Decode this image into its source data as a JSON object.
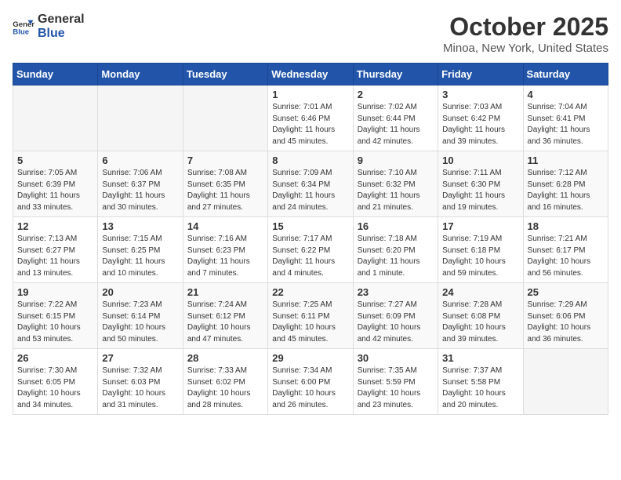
{
  "header": {
    "logo_general": "General",
    "logo_blue": "Blue",
    "month_title": "October 2025",
    "location": "Minoa, New York, United States"
  },
  "days_of_week": [
    "Sunday",
    "Monday",
    "Tuesday",
    "Wednesday",
    "Thursday",
    "Friday",
    "Saturday"
  ],
  "weeks": [
    [
      {
        "day": "",
        "info": ""
      },
      {
        "day": "",
        "info": ""
      },
      {
        "day": "",
        "info": ""
      },
      {
        "day": "1",
        "info": "Sunrise: 7:01 AM\nSunset: 6:46 PM\nDaylight: 11 hours and 45 minutes."
      },
      {
        "day": "2",
        "info": "Sunrise: 7:02 AM\nSunset: 6:44 PM\nDaylight: 11 hours and 42 minutes."
      },
      {
        "day": "3",
        "info": "Sunrise: 7:03 AM\nSunset: 6:42 PM\nDaylight: 11 hours and 39 minutes."
      },
      {
        "day": "4",
        "info": "Sunrise: 7:04 AM\nSunset: 6:41 PM\nDaylight: 11 hours and 36 minutes."
      }
    ],
    [
      {
        "day": "5",
        "info": "Sunrise: 7:05 AM\nSunset: 6:39 PM\nDaylight: 11 hours and 33 minutes."
      },
      {
        "day": "6",
        "info": "Sunrise: 7:06 AM\nSunset: 6:37 PM\nDaylight: 11 hours and 30 minutes."
      },
      {
        "day": "7",
        "info": "Sunrise: 7:08 AM\nSunset: 6:35 PM\nDaylight: 11 hours and 27 minutes."
      },
      {
        "day": "8",
        "info": "Sunrise: 7:09 AM\nSunset: 6:34 PM\nDaylight: 11 hours and 24 minutes."
      },
      {
        "day": "9",
        "info": "Sunrise: 7:10 AM\nSunset: 6:32 PM\nDaylight: 11 hours and 21 minutes."
      },
      {
        "day": "10",
        "info": "Sunrise: 7:11 AM\nSunset: 6:30 PM\nDaylight: 11 hours and 19 minutes."
      },
      {
        "day": "11",
        "info": "Sunrise: 7:12 AM\nSunset: 6:28 PM\nDaylight: 11 hours and 16 minutes."
      }
    ],
    [
      {
        "day": "12",
        "info": "Sunrise: 7:13 AM\nSunset: 6:27 PM\nDaylight: 11 hours and 13 minutes."
      },
      {
        "day": "13",
        "info": "Sunrise: 7:15 AM\nSunset: 6:25 PM\nDaylight: 11 hours and 10 minutes."
      },
      {
        "day": "14",
        "info": "Sunrise: 7:16 AM\nSunset: 6:23 PM\nDaylight: 11 hours and 7 minutes."
      },
      {
        "day": "15",
        "info": "Sunrise: 7:17 AM\nSunset: 6:22 PM\nDaylight: 11 hours and 4 minutes."
      },
      {
        "day": "16",
        "info": "Sunrise: 7:18 AM\nSunset: 6:20 PM\nDaylight: 11 hours and 1 minute."
      },
      {
        "day": "17",
        "info": "Sunrise: 7:19 AM\nSunset: 6:18 PM\nDaylight: 10 hours and 59 minutes."
      },
      {
        "day": "18",
        "info": "Sunrise: 7:21 AM\nSunset: 6:17 PM\nDaylight: 10 hours and 56 minutes."
      }
    ],
    [
      {
        "day": "19",
        "info": "Sunrise: 7:22 AM\nSunset: 6:15 PM\nDaylight: 10 hours and 53 minutes."
      },
      {
        "day": "20",
        "info": "Sunrise: 7:23 AM\nSunset: 6:14 PM\nDaylight: 10 hours and 50 minutes."
      },
      {
        "day": "21",
        "info": "Sunrise: 7:24 AM\nSunset: 6:12 PM\nDaylight: 10 hours and 47 minutes."
      },
      {
        "day": "22",
        "info": "Sunrise: 7:25 AM\nSunset: 6:11 PM\nDaylight: 10 hours and 45 minutes."
      },
      {
        "day": "23",
        "info": "Sunrise: 7:27 AM\nSunset: 6:09 PM\nDaylight: 10 hours and 42 minutes."
      },
      {
        "day": "24",
        "info": "Sunrise: 7:28 AM\nSunset: 6:08 PM\nDaylight: 10 hours and 39 minutes."
      },
      {
        "day": "25",
        "info": "Sunrise: 7:29 AM\nSunset: 6:06 PM\nDaylight: 10 hours and 36 minutes."
      }
    ],
    [
      {
        "day": "26",
        "info": "Sunrise: 7:30 AM\nSunset: 6:05 PM\nDaylight: 10 hours and 34 minutes."
      },
      {
        "day": "27",
        "info": "Sunrise: 7:32 AM\nSunset: 6:03 PM\nDaylight: 10 hours and 31 minutes."
      },
      {
        "day": "28",
        "info": "Sunrise: 7:33 AM\nSunset: 6:02 PM\nDaylight: 10 hours and 28 minutes."
      },
      {
        "day": "29",
        "info": "Sunrise: 7:34 AM\nSunset: 6:00 PM\nDaylight: 10 hours and 26 minutes."
      },
      {
        "day": "30",
        "info": "Sunrise: 7:35 AM\nSunset: 5:59 PM\nDaylight: 10 hours and 23 minutes."
      },
      {
        "day": "31",
        "info": "Sunrise: 7:37 AM\nSunset: 5:58 PM\nDaylight: 10 hours and 20 minutes."
      },
      {
        "day": "",
        "info": ""
      }
    ]
  ]
}
